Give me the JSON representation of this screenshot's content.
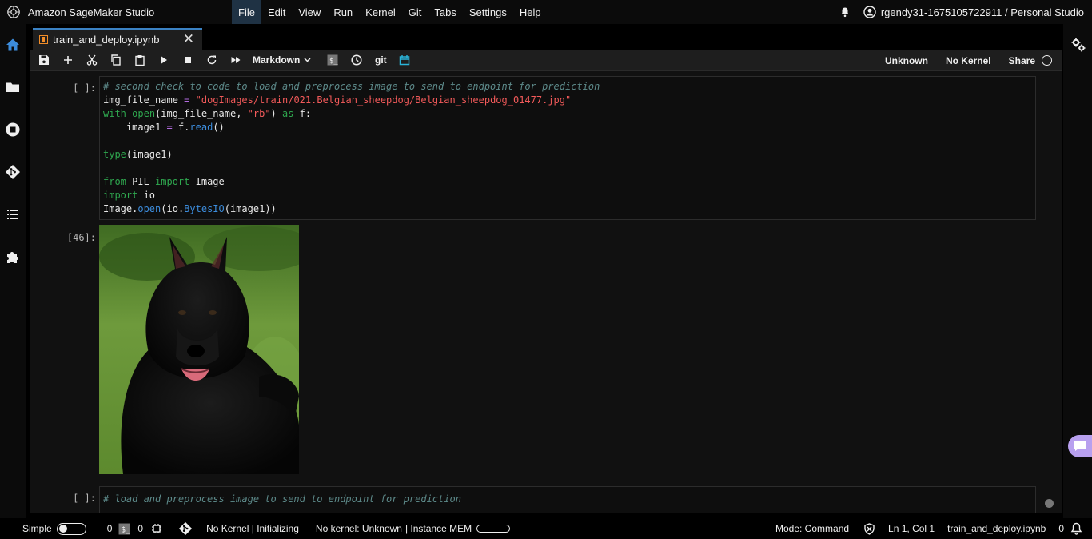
{
  "app": {
    "title": "Amazon SageMaker Studio"
  },
  "menu": [
    "File",
    "Edit",
    "View",
    "Run",
    "Kernel",
    "Git",
    "Tabs",
    "Settings",
    "Help"
  ],
  "user": {
    "label": "rgendy31-1675105722911 / Personal Studio"
  },
  "tab": {
    "label": "train_and_deploy.ipynb",
    "close": "✕"
  },
  "toolbar": {
    "cell_type": "Markdown",
    "git_label": "git",
    "kernel_status": "Unknown",
    "kernel_name": "No Kernel",
    "share": "Share"
  },
  "cells": [
    {
      "prompt": "[ ]:",
      "lines": [
        "# second check to code to load and preprocess image to send to endpoint for prediction",
        "img_file_name = \"dogImages/train/021.Belgian_sheepdog/Belgian_sheepdog_01477.jpg\"",
        "with open(img_file_name, \"rb\") as f:",
        "    image1 = f.read()",
        "",
        "type(image1)",
        "",
        "from PIL import Image",
        "import io",
        "Image.open(io.BytesIO(image1))"
      ]
    },
    {
      "prompt": "[46]:",
      "output": "image of a black Belgian sheepdog on grass"
    },
    {
      "prompt": "[ ]:",
      "lines": [
        "# load and preprocess image to send to endpoint for prediction"
      ]
    }
  ],
  "status": {
    "mode_toggle": "Simple",
    "count_a": "0",
    "count_b": "0",
    "kernel_state": "No Kernel | Initializing",
    "kernel_info": "No kernel: Unknown",
    "mem_label": "| Instance MEM",
    "mode": "Mode: Command",
    "cursor": "Ln 1, Col 1",
    "file": "train_and_deploy.ipynb",
    "notifications": "0"
  },
  "colors": {
    "accent": "#3b82c4",
    "notebook_icon": "#f08c28",
    "chat": "#b8a0ef"
  }
}
